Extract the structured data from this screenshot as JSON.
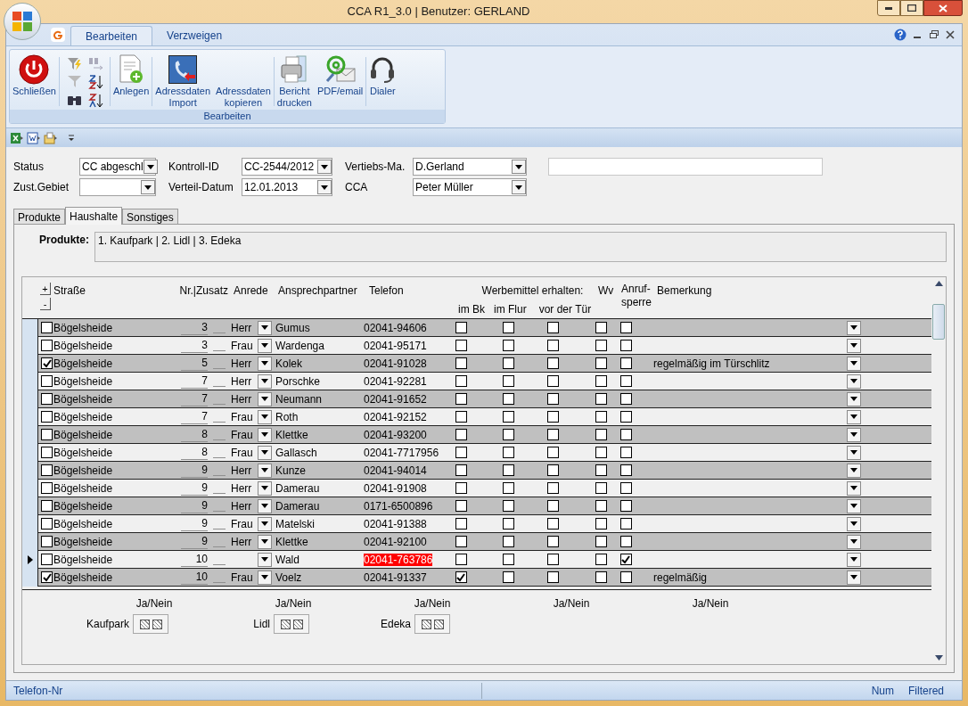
{
  "window": {
    "title": "CCA R1_3.0 | Benutzer: GERLAND"
  },
  "ribbon": {
    "tabs": [
      {
        "label": "Bearbeiten",
        "selected": true
      },
      {
        "label": "Verzweigen",
        "selected": false
      }
    ],
    "group_label": "Bearbeiten",
    "buttons": [
      {
        "kind": "power",
        "label": "Schließen"
      },
      {
        "kind": "small"
      },
      {
        "kind": "document",
        "label": "Anlegen"
      },
      {
        "kind": "phone",
        "label": "Adressdaten Import"
      },
      {
        "kind": "none",
        "label": "Adressdaten kopieren"
      },
      {
        "kind": "printer",
        "label": "Bericht drucken"
      },
      {
        "kind": "email",
        "label": "PDF/email"
      },
      {
        "kind": "headset",
        "label": "Dialer"
      }
    ]
  },
  "form": {
    "fields": [
      {
        "label": "Status",
        "value": "CC abgeschl"
      },
      {
        "label": "Kontroll-ID",
        "value": "CC-2544/2012"
      },
      {
        "label": "Vertiebs-Ma.",
        "value": "D.Gerland"
      },
      {
        "label": "Zust.Gebiet"
      },
      {
        "label": "Verteil-Datum",
        "value": "12.01.2013"
      },
      {
        "label": "CCA",
        "value": "Peter Müller"
      }
    ]
  },
  "tabs": [
    {
      "label": "Produkte",
      "selected": false
    },
    {
      "label": "Haushalte",
      "selected": true
    },
    {
      "label": "Sonstiges",
      "selected": false
    }
  ],
  "produkte": {
    "label": "Produkte:",
    "value": "1. Kaufpark | 2. Lidl | 3. Edeka"
  },
  "table": {
    "headers": {
      "strasse": "Straße",
      "nr_zusatz": "Nr.|Zusatz",
      "anrede": "Anrede",
      "ansprechpartner": "Ansprechpartner",
      "telefon": "Telefon",
      "werbemittel": "Werbemittel erhalten:",
      "im_bk": "im Bk",
      "im_flur": "im Flur",
      "vor_der_tuer": "vor der Tür",
      "wv": "Wv",
      "anrufsperre": "Anruf-\nsperre",
      "bemerkung": "Bemerkung",
      "expand": "+",
      "collapse": "-"
    },
    "rows": [
      {
        "marked": false,
        "street": "Bögelsheide",
        "nr": "3",
        "anrede": "Herr",
        "name": "Gumus",
        "phone": "02041-94606",
        "im_bk": false,
        "im_flur": false,
        "vor_der_tuer": false,
        "wv": false,
        "anrufsperre": false,
        "current": false
      },
      {
        "marked": false,
        "street": "Bögelsheide",
        "nr": "3",
        "anrede": "Frau",
        "name": "Wardenga",
        "phone": "02041-95171",
        "im_bk": false,
        "im_flur": false,
        "vor_der_tuer": false,
        "wv": false,
        "anrufsperre": false,
        "current": false
      },
      {
        "marked": true,
        "street": "Bögelsheide",
        "nr": "5",
        "anrede": "Herr",
        "name": "Kolek",
        "phone": "02041-91028",
        "im_bk": false,
        "im_flur": false,
        "vor_der_tuer": false,
        "wv": false,
        "anrufsperre": false,
        "bemerkung": "regelmäßig im Türschlitz",
        "current": false
      },
      {
        "marked": false,
        "street": "Bögelsheide",
        "nr": "7",
        "anrede": "Herr",
        "name": "Porschke",
        "phone": "02041-92281",
        "im_bk": false,
        "im_flur": false,
        "vor_der_tuer": false,
        "wv": false,
        "anrufsperre": false,
        "current": false
      },
      {
        "marked": false,
        "street": "Bögelsheide",
        "nr": "7",
        "anrede": "Herr",
        "name": "Neumann",
        "phone": "02041-91652",
        "im_bk": false,
        "im_flur": false,
        "vor_der_tuer": false,
        "wv": false,
        "anrufsperre": false,
        "current": false
      },
      {
        "marked": false,
        "street": "Bögelsheide",
        "nr": "7",
        "anrede": "Frau",
        "name": "Roth",
        "phone": "02041-92152",
        "im_bk": false,
        "im_flur": false,
        "vor_der_tuer": false,
        "wv": false,
        "anrufsperre": false,
        "current": false
      },
      {
        "marked": false,
        "street": "Bögelsheide",
        "nr": "8",
        "anrede": "Frau",
        "name": "Klettke",
        "phone": "02041-93200",
        "im_bk": false,
        "im_flur": false,
        "vor_der_tuer": false,
        "wv": false,
        "anrufsperre": false,
        "current": false
      },
      {
        "marked": false,
        "street": "Bögelsheide",
        "nr": "8",
        "anrede": "Frau",
        "name": "Gallasch",
        "phone": "02041-7717956",
        "im_bk": false,
        "im_flur": false,
        "vor_der_tuer": false,
        "wv": false,
        "anrufsperre": false,
        "current": false
      },
      {
        "marked": false,
        "street": "Bögelsheide",
        "nr": "9",
        "anrede": "Herr",
        "name": "Kunze",
        "phone": "02041-94014",
        "im_bk": false,
        "im_flur": false,
        "vor_der_tuer": false,
        "wv": false,
        "anrufsperre": false,
        "current": false
      },
      {
        "marked": false,
        "street": "Bögelsheide",
        "nr": "9",
        "anrede": "Herr",
        "name": "Damerau",
        "phone": "02041-91908",
        "im_bk": false,
        "im_flur": false,
        "vor_der_tuer": false,
        "wv": false,
        "anrufsperre": false,
        "current": false
      },
      {
        "marked": false,
        "street": "Bögelsheide",
        "nr": "9",
        "anrede": "Herr",
        "name": "Damerau",
        "phone": "0171-6500896",
        "im_bk": false,
        "im_flur": false,
        "vor_der_tuer": false,
        "wv": false,
        "anrufsperre": false,
        "current": false
      },
      {
        "marked": false,
        "street": "Bögelsheide",
        "nr": "9",
        "anrede": "Frau",
        "name": "Matelski",
        "phone": "02041-91388",
        "im_bk": false,
        "im_flur": false,
        "vor_der_tuer": false,
        "wv": false,
        "anrufsperre": false,
        "current": false
      },
      {
        "marked": false,
        "street": "Bögelsheide",
        "nr": "9",
        "anrede": "Herr",
        "name": "Klettke",
        "phone": "02041-92100",
        "im_bk": false,
        "im_flur": false,
        "vor_der_tuer": false,
        "wv": false,
        "anrufsperre": false,
        "current": false
      },
      {
        "marked": false,
        "street": "Bögelsheide",
        "nr": "10",
        "name": "Wald",
        "phone": "02041-763786",
        "im_bk": false,
        "im_flur": false,
        "vor_der_tuer": false,
        "wv": false,
        "anrufsperre": true,
        "current": true
      },
      {
        "marked": true,
        "street": "Bögelsheide",
        "nr": "10",
        "anrede": "Frau",
        "name": "Voelz",
        "phone": "02041-91337",
        "im_bk": true,
        "im_flur": false,
        "vor_der_tuer": false,
        "wv": false,
        "anrufsperre": false,
        "bemerkung": "regelmäßig",
        "current": false
      }
    ]
  },
  "footer": {
    "ja_nein": [
      "Ja/Nein",
      "Ja/Nein",
      "Ja/Nein",
      "Ja/Nein",
      "Ja/Nein"
    ],
    "products": [
      {
        "label": "Kaufpark",
        "indeterminate": true
      },
      {
        "label": "Lidl",
        "indeterminate": true
      },
      {
        "label": "Edeka",
        "indeterminate": true
      }
    ]
  },
  "status_bar": {
    "left": "Telefon-Nr",
    "num": "Num",
    "filter": "Filtered"
  }
}
